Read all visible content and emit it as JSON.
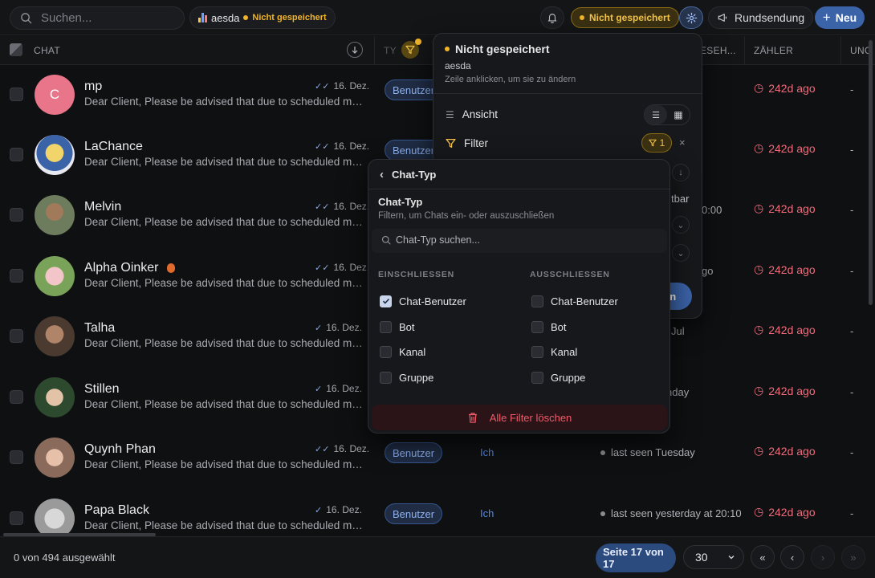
{
  "topbar": {
    "search_placeholder": "Suchen...",
    "view_name": "aesda",
    "view_status": "Nicht gespeichert",
    "unsaved_label": "Nicht gespeichert",
    "broadcast_label": "Rundsendung",
    "new_label": "Neu"
  },
  "columns": {
    "chat": "CHAT",
    "type_partial": "TY",
    "lastseen_partial": "ESEH...",
    "counter": "ZÄHLER",
    "unread_partial": "UNG"
  },
  "rows": [
    {
      "name": "mp",
      "initial": "C",
      "date": "16. Dez.",
      "preview": "Dear Client, Please be advised that due to scheduled maintenance",
      "type": "Benutzer",
      "owner": "",
      "lastseen": "",
      "counter": "242d ago",
      "unread": "-"
    },
    {
      "name": "LaChance",
      "date": "16. Dez.",
      "preview": "Dear Client, Please be advised that due to scheduled maintenance",
      "type": "Benutzer",
      "owner": "",
      "lastseen": "",
      "counter": "242d ago",
      "unread": "-"
    },
    {
      "name": "Melvin",
      "date": "16. Dez.",
      "preview": "Dear Client, Please be advised that due to scheduled maintenance",
      "type": "",
      "owner": "",
      "lastseen": "0:00",
      "counter": "242d ago",
      "unread": "-"
    },
    {
      "name": "Alpha Oinker",
      "date": "16. Dez.",
      "preview": "Dear Client, Please be advised that due to scheduled maintenance",
      "type": "",
      "owner": "",
      "lastseen": "go",
      "counter": "242d ago",
      "unread": "-"
    },
    {
      "name": "Talha",
      "date": "16. Dez.",
      "preview": "Dear Client, Please be advised that due to scheduled maintenance",
      "type": "",
      "owner": "",
      "lastseen": "Jul",
      "counter": "242d ago",
      "unread": "-"
    },
    {
      "name": "Stillen",
      "date": "16. Dez.",
      "preview": "Dear Client, Please be advised that due to scheduled maintenance",
      "type": "",
      "owner": "",
      "lastseen": "nday",
      "counter": "242d ago",
      "unread": "-"
    },
    {
      "name": "Quynh Phan",
      "date": "16. Dez.",
      "preview": "Dear Client, Please be advised that due to scheduled maintenance",
      "type": "Benutzer",
      "owner": "Ich",
      "lastseen": "last seen Tuesday",
      "counter": "242d ago",
      "unread": "-"
    },
    {
      "name": "Papa Black",
      "date": "16. Dez.",
      "preview": "Dear Client, Please be advised that due to scheduled maintenance",
      "type": "Benutzer",
      "owner": "Ich",
      "lastseen": "last seen yesterday at 20:10",
      "counter": "242d ago",
      "unread": "-"
    }
  ],
  "footer": {
    "selected": "0 von 494 ausgewählt",
    "page_label": "Seite 17 von 17",
    "page_size": "30"
  },
  "settings_popover": {
    "title": "Nicht gespeichert",
    "view_name": "aesda",
    "hint": "Zeile anklicken, um sie zu ändern",
    "view_label": "Ansicht",
    "filter_label": "Filter",
    "filter_count": "1",
    "partial_text": "tbar",
    "partial_button": "ren"
  },
  "chat_type_menu": {
    "back_title": "Chat-Typ",
    "heading": "Chat-Typ",
    "description": "Filtern, um Chats ein- oder auszuschließen",
    "search_placeholder": "Chat-Typ suchen...",
    "include_header": "EINSCHLIESSEN",
    "exclude_header": "AUSSCHLIESSEN",
    "include_options": [
      {
        "label": "Chat-Benutzer",
        "checked": true
      },
      {
        "label": "Bot",
        "checked": false
      },
      {
        "label": "Kanal",
        "checked": false
      },
      {
        "label": "Gruppe",
        "checked": false
      }
    ],
    "exclude_options": [
      {
        "label": "Chat-Benutzer",
        "checked": false
      },
      {
        "label": "Bot",
        "checked": false
      },
      {
        "label": "Kanal",
        "checked": false
      },
      {
        "label": "Gruppe",
        "checked": false
      }
    ],
    "clear_all": "Alle Filter löschen"
  },
  "colors": {
    "accent": "#3b63a8",
    "warning": "#f0b429",
    "danger": "#f06a7c",
    "link": "#4f86ea"
  }
}
